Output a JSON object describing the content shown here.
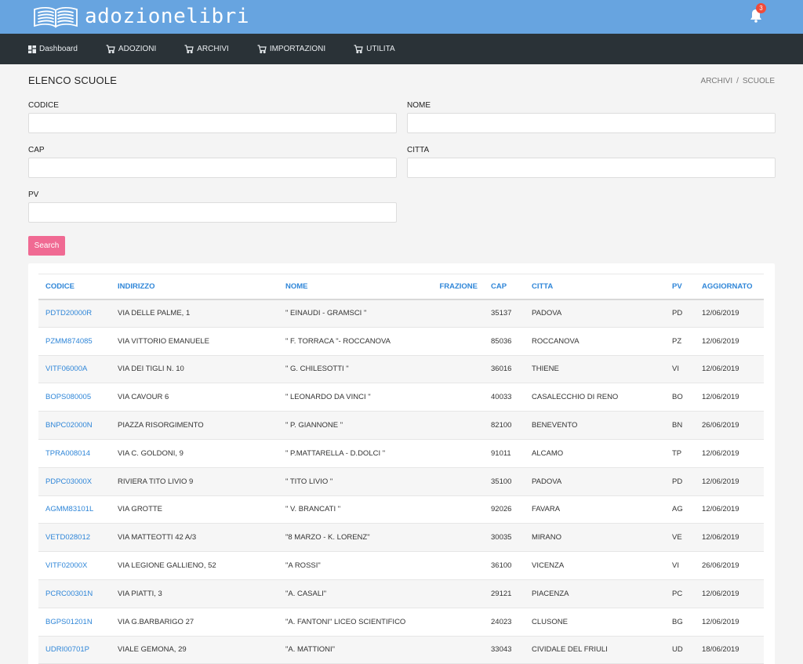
{
  "app": {
    "title": "adozionelibri",
    "notifications": "3"
  },
  "nav": [
    {
      "label": "Dashboard",
      "icon": "dashboard-icon"
    },
    {
      "label": "ADOZIONI",
      "icon": "cart-icon"
    },
    {
      "label": "ARCHIVI",
      "icon": "cart-icon"
    },
    {
      "label": "IMPORTAZIONI",
      "icon": "cart-icon"
    },
    {
      "label": "UTILITA",
      "icon": "cart-icon"
    }
  ],
  "page": {
    "title": "ELENCO SCUOLE",
    "breadcrumb": [
      "ARCHIVI",
      "SCUOLE"
    ]
  },
  "form": {
    "codice": {
      "label": "CODICE",
      "value": ""
    },
    "nome": {
      "label": "NOME",
      "value": ""
    },
    "cap": {
      "label": "CAP",
      "value": ""
    },
    "citta": {
      "label": "CITTA",
      "value": ""
    },
    "pv": {
      "label": "PV",
      "value": ""
    },
    "search_label": "Search"
  },
  "table": {
    "headers": [
      "CODICE",
      "INDIRIZZO",
      "NOME",
      "FRAZIONE",
      "CAP",
      "CITTA",
      "PV",
      "AGGIORNATO"
    ],
    "rows": [
      [
        "PDTD20000R",
        "VIA DELLE PALME, 1",
        "\" EINAUDI - GRAMSCI \"",
        "",
        "35137",
        "PADOVA",
        "PD",
        "12/06/2019"
      ],
      [
        "PZMM874085",
        "VIA VITTORIO EMANUELE",
        "\" F. TORRACA \"- ROCCANOVA",
        "",
        "85036",
        "ROCCANOVA",
        "PZ",
        "12/06/2019"
      ],
      [
        "VITF06000A",
        "VIA DEI TIGLI N. 10",
        "\" G. CHILESOTTI \"",
        "",
        "36016",
        "THIENE",
        "VI",
        "12/06/2019"
      ],
      [
        "BOPS080005",
        "VIA CAVOUR 6",
        "\" LEONARDO DA VINCI \"",
        "",
        "40033",
        "CASALECCHIO DI RENO",
        "BO",
        "12/06/2019"
      ],
      [
        "BNPC02000N",
        "PIAZZA RISORGIMENTO",
        "\" P. GIANNONE \"",
        "",
        "82100",
        "BENEVENTO",
        "BN",
        "26/06/2019"
      ],
      [
        "TPRA008014",
        "VIA C. GOLDONI, 9",
        "\" P.MATTARELLA - D.DOLCI \"",
        "",
        "91011",
        "ALCAMO",
        "TP",
        "12/06/2019"
      ],
      [
        "PDPC03000X",
        "RIVIERA TITO LIVIO 9",
        "\" TITO LIVIO \"",
        "",
        "35100",
        "PADOVA",
        "PD",
        "12/06/2019"
      ],
      [
        "AGMM83101L",
        "VIA GROTTE",
        "\" V. BRANCATI \"",
        "",
        "92026",
        "FAVARA",
        "AG",
        "12/06/2019"
      ],
      [
        "VETD028012",
        "VIA MATTEOTTI 42 A/3",
        "\"8 MARZO - K. LORENZ\"",
        "",
        "30035",
        "MIRANO",
        "VE",
        "12/06/2019"
      ],
      [
        "VITF02000X",
        "VIA LEGIONE GALLIENO, 52",
        "\"A ROSSI\"",
        "",
        "36100",
        "VICENZA",
        "VI",
        "26/06/2019"
      ],
      [
        "PCRC00301N",
        "VIA PIATTI, 3",
        "\"A. CASALI\"",
        "",
        "29121",
        "PIACENZA",
        "PC",
        "12/06/2019"
      ],
      [
        "BGPS01201N",
        "VIA G.BARBARIGO 27",
        "\"A. FANTONI\" LICEO SCIENTIFICO",
        "",
        "24023",
        "CLUSONE",
        "BG",
        "12/06/2019"
      ],
      [
        "UDRI00701P",
        "VIALE GEMONA, 29",
        "\"A. MATTIONI\"",
        "",
        "33043",
        "CIVIDALE DEL FRIULI",
        "UD",
        "18/06/2019"
      ],
      [
        "",
        "",
        "",
        "",
        "",
        "",
        "",
        ""
      ]
    ]
  }
}
